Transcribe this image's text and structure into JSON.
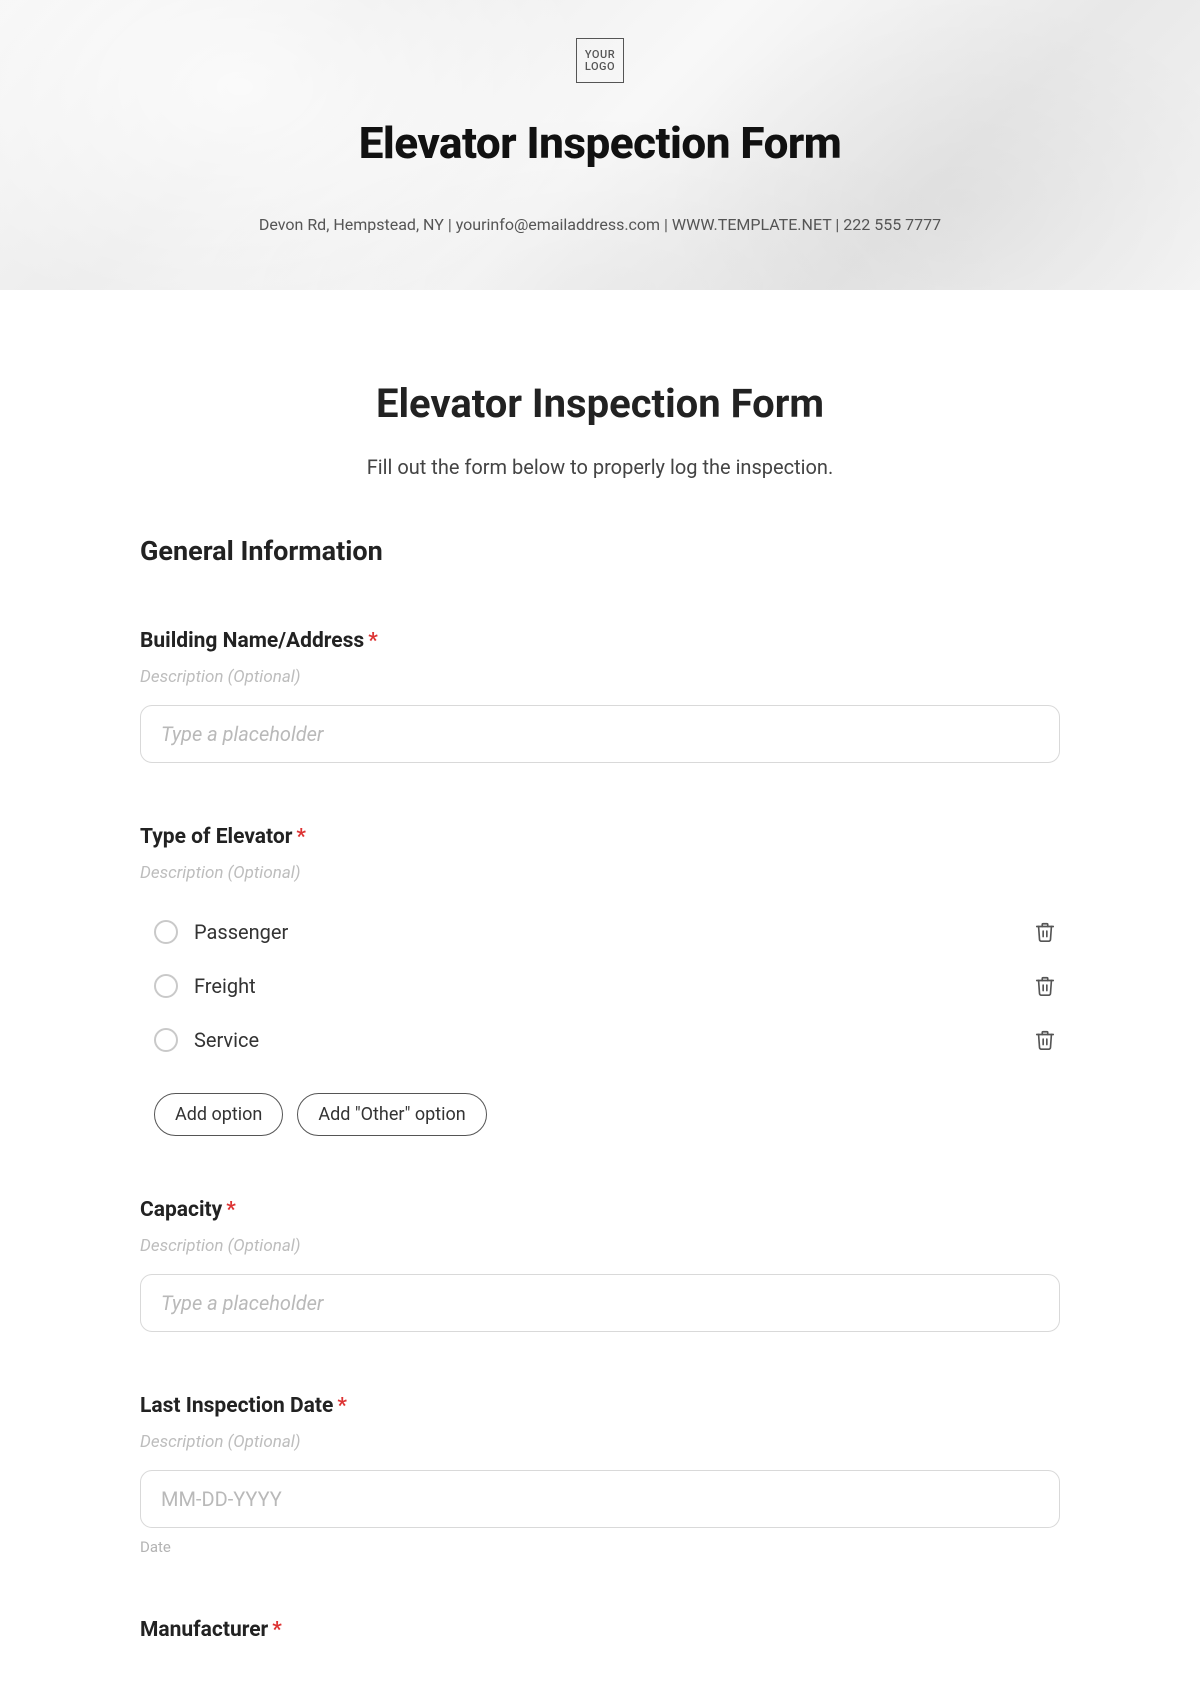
{
  "hero": {
    "logo_line1": "YOUR",
    "logo_line2": "LOGO",
    "title": "Elevator Inspection Form",
    "contact": "Devon Rd, Hempstead, NY | yourinfo@emailaddress.com | WWW.TEMPLATE.NET | 222 555 7777"
  },
  "form": {
    "title": "Elevator Inspection Form",
    "subtitle": "Fill out the form below to properly log the inspection.",
    "section_general": "General Information",
    "desc_placeholder": "Description (Optional)",
    "input_placeholder": "Type a placeholder",
    "add_option": "Add option",
    "add_other": "Add \"Other\" option",
    "date_placeholder": "MM-DD-YYYY",
    "date_helper": "Date",
    "fields": {
      "building": {
        "label": "Building Name/Address"
      },
      "type": {
        "label": "Type of Elevator"
      },
      "capacity": {
        "label": "Capacity"
      },
      "lastdate": {
        "label": "Last Inspection Date"
      },
      "manuf": {
        "label": "Manufacturer"
      }
    },
    "type_options": [
      "Passenger",
      "Freight",
      "Service"
    ]
  }
}
